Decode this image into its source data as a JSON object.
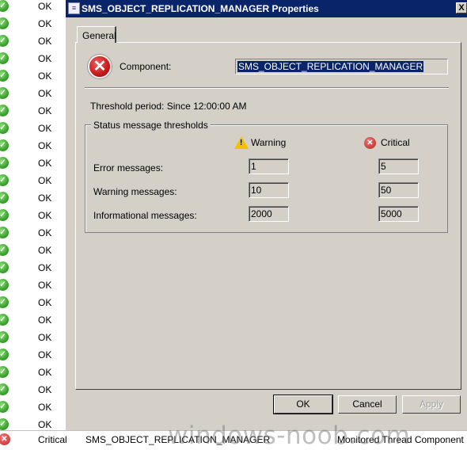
{
  "list": {
    "ok_label": "OK",
    "ok_rows": [
      0,
      1,
      2,
      3,
      4,
      5,
      6,
      7,
      8,
      9,
      10,
      11,
      12,
      13,
      14,
      15,
      16,
      17,
      18,
      19,
      20,
      21,
      22,
      23,
      24
    ],
    "bottom_row": {
      "status": "Critical",
      "component": "SMS_OBJECT_REPLICATION_MANAGER",
      "type": "Monitored Thread Component"
    }
  },
  "dialog": {
    "title": "SMS_OBJECT_REPLICATION_MANAGER Properties",
    "close": "X",
    "tab": "General",
    "component_label": "Component:",
    "component_value": "SMS_OBJECT_REPLICATION_MANAGER",
    "threshold_period": "Threshold period:  Since 12:00:00 AM",
    "group_label": "Status message thresholds",
    "warning_header": "Warning",
    "critical_header": "Critical",
    "rows": [
      {
        "label": "Error messages:",
        "warning": "1",
        "critical": "5"
      },
      {
        "label": "Warning messages:",
        "warning": "10",
        "critical": "50"
      },
      {
        "label": "Informational messages:",
        "warning": "2000",
        "critical": "5000"
      }
    ],
    "buttons": {
      "ok": "OK",
      "cancel": "Cancel",
      "apply": "Apply"
    }
  },
  "watermark": "windows-noob.com",
  "colors": {
    "titlebar": "#0a246a",
    "dialog_bg": "#d4d0c8",
    "ok_green": "#2f9a22",
    "critical_red": "#c01515"
  }
}
